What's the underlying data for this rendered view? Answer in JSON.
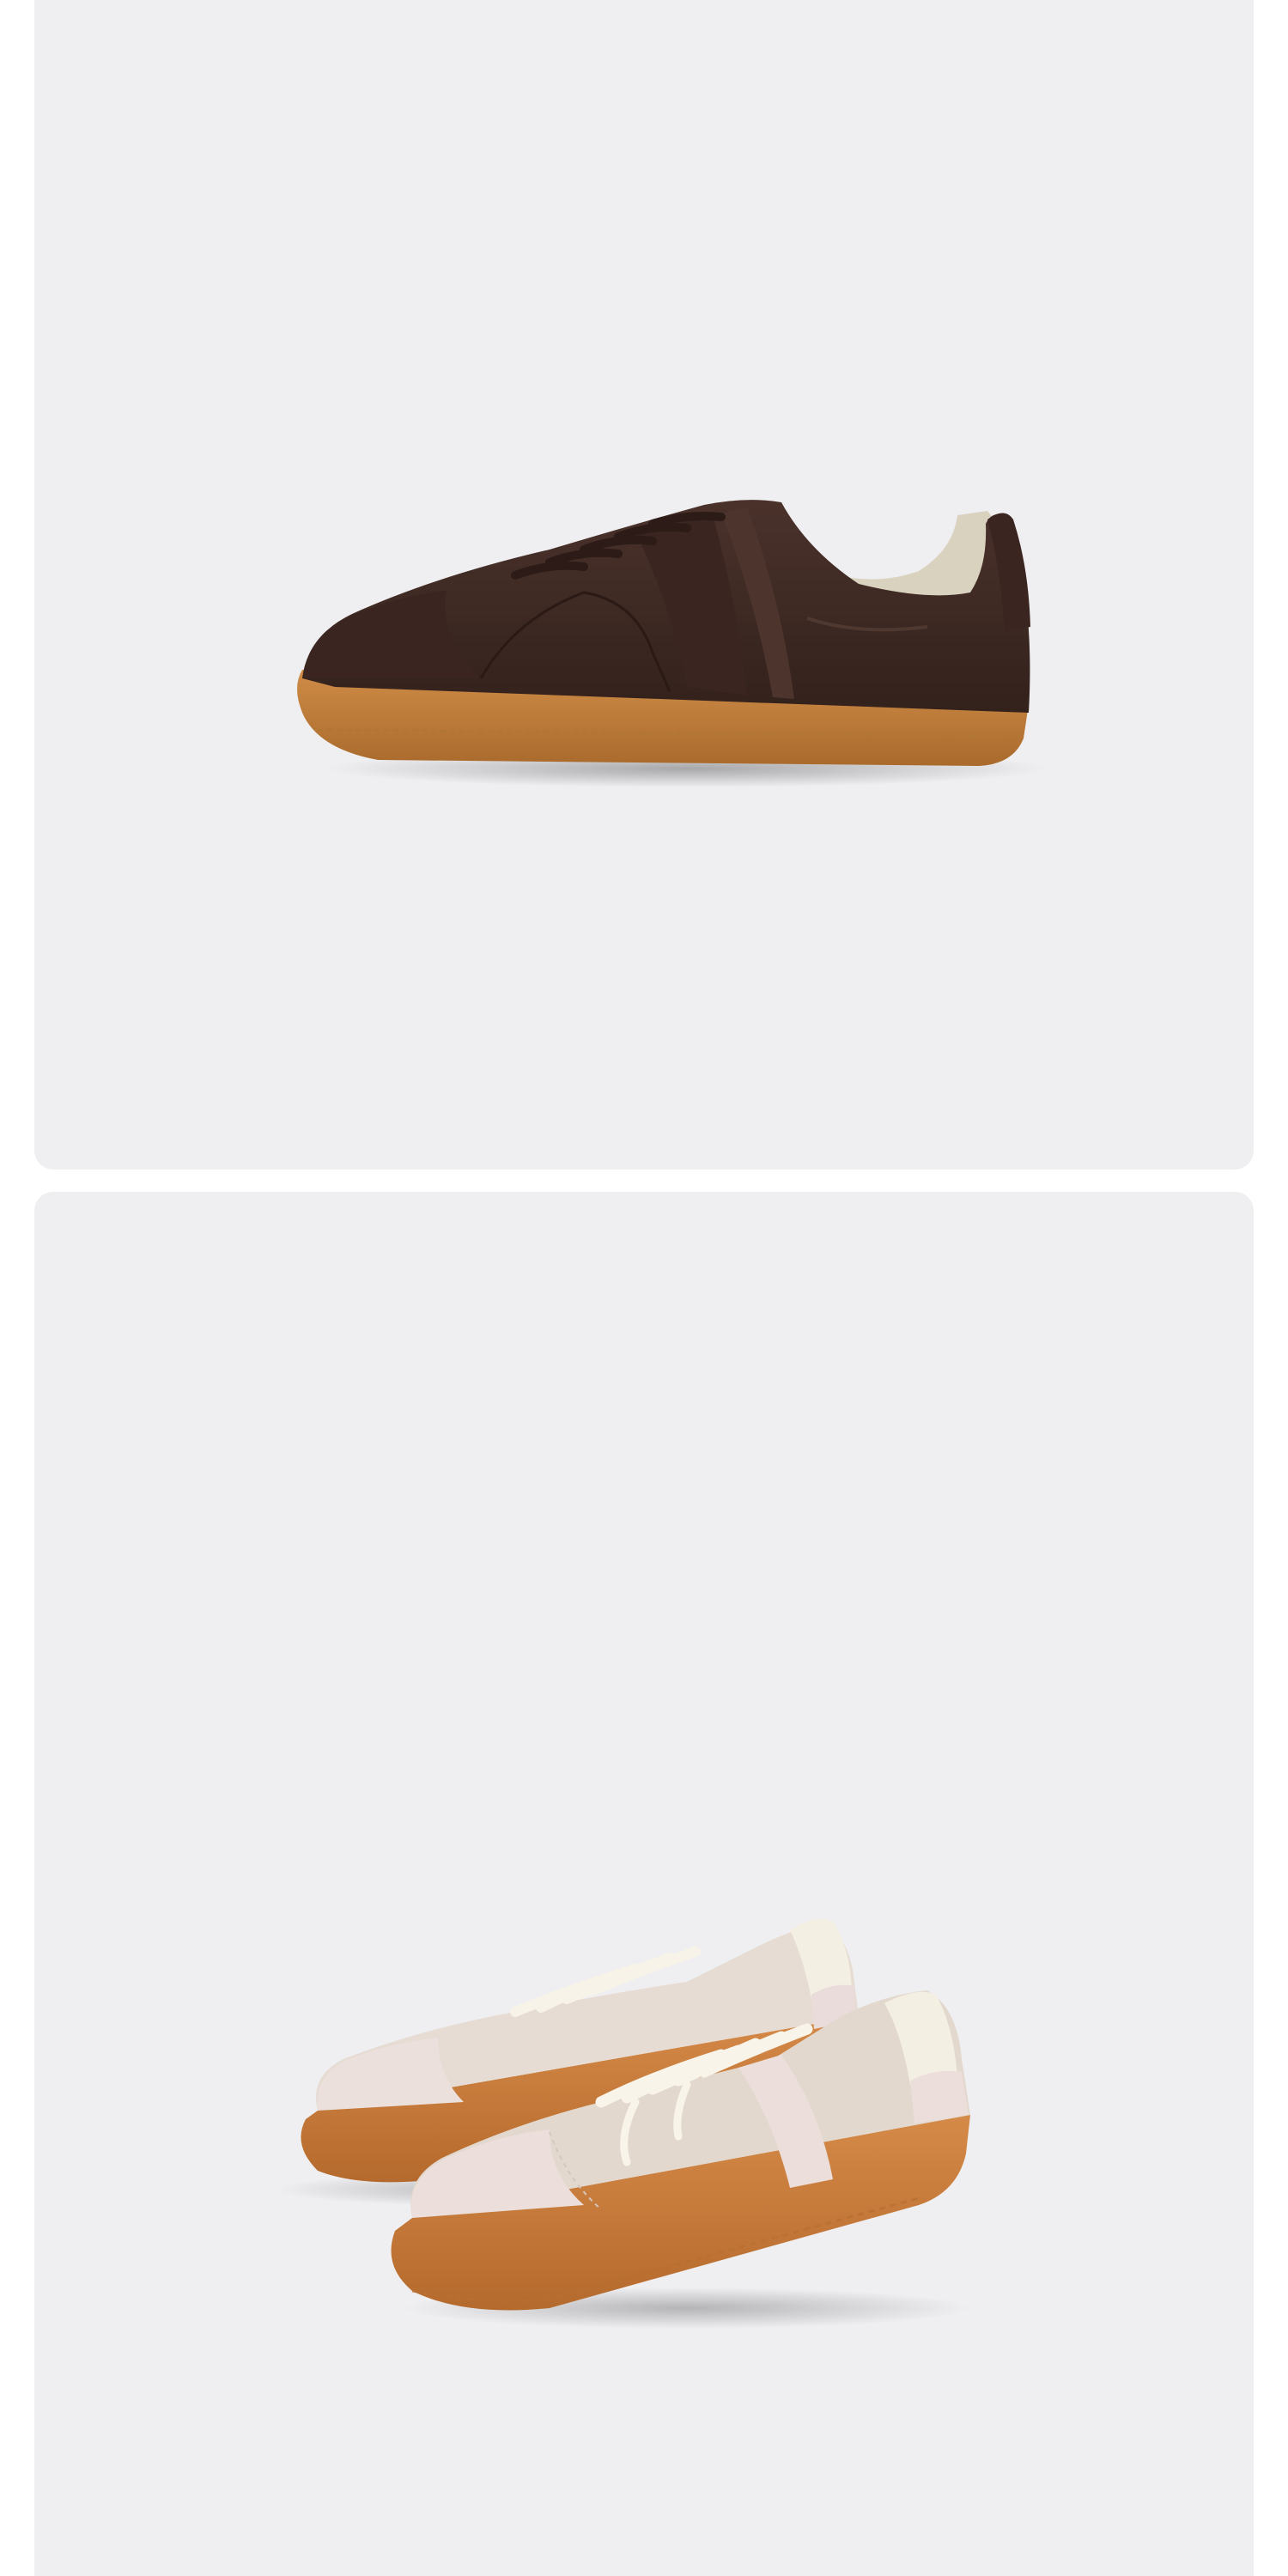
{
  "gallery": {
    "images": [
      {
        "subject": "sneaker-brown-side",
        "colors": {
          "upper": "#3f2a24",
          "suede": "#3a2520",
          "sole": "#c3823f",
          "lining": "#d9d2bf"
        }
      },
      {
        "subject": "sneaker-beige-pair",
        "colors": {
          "upper": "#e2d8ce",
          "suede": "#eadbd8",
          "sole": "#c97b3e",
          "laces": "#f5f1e6"
        }
      }
    ],
    "background_color": "#efeff1"
  }
}
